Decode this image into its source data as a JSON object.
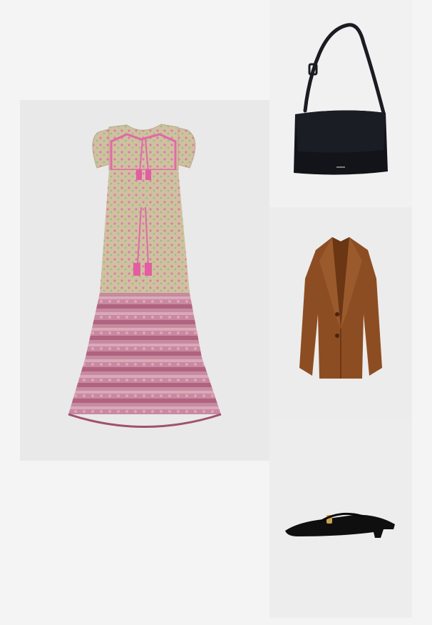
{
  "outfit": {
    "items": [
      {
        "name": "dress",
        "color": "#c9b79a",
        "accent": "#e06aa6"
      },
      {
        "name": "bag",
        "color": "#111318"
      },
      {
        "name": "blazer",
        "color": "#8a4c22"
      },
      {
        "name": "mule",
        "color": "#0d0d0d"
      }
    ],
    "background": "#f4f4f4"
  }
}
